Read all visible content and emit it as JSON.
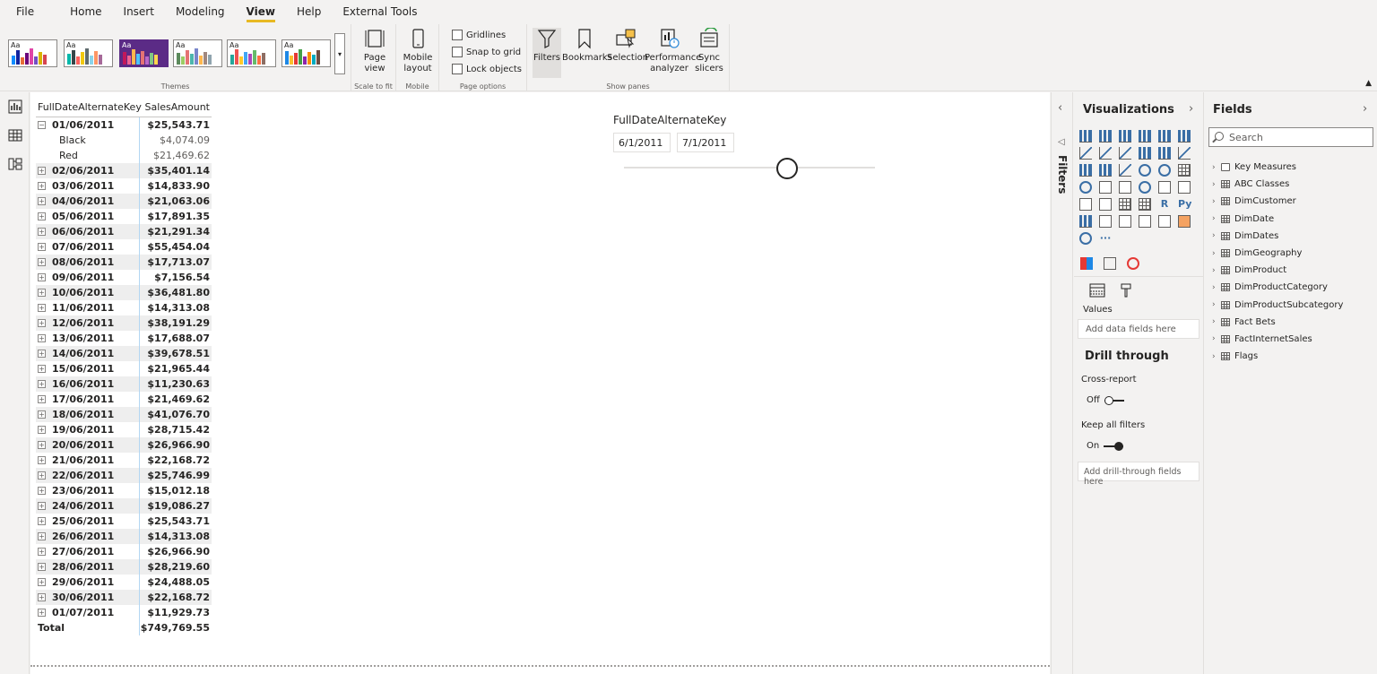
{
  "menu": [
    "File",
    "Home",
    "Insert",
    "Modeling",
    "View",
    "Help",
    "External Tools"
  ],
  "menu_active": "View",
  "ribbon": {
    "themes_label": "Themes",
    "page_view": "Page view",
    "scale_to_fit": "Scale to fit",
    "mobile_layout": "Mobile layout",
    "mobile_group": "Mobile",
    "gridlines": "Gridlines",
    "snap_to_grid": "Snap to grid",
    "lock_objects": "Lock objects",
    "page_options": "Page options",
    "filters": "Filters",
    "bookmarks": "Bookmarks",
    "selection": "Selection",
    "performance_analyzer": "Performance analyzer",
    "sync_slicers": "Sync slicers",
    "show_panes": "Show panes",
    "theme_aa": "Aa"
  },
  "table": {
    "col1": "FullDateAlternateKey",
    "col2": "SalesAmount",
    "rows": [
      {
        "key": "01/06/2011",
        "value": "$25,543.71",
        "expanded": true
      },
      {
        "key": "Black",
        "value": "$4,074.09",
        "child": true
      },
      {
        "key": "Red",
        "value": "$21,469.62",
        "child": true
      },
      {
        "key": "02/06/2011",
        "value": "$35,401.14"
      },
      {
        "key": "03/06/2011",
        "value": "$14,833.90"
      },
      {
        "key": "04/06/2011",
        "value": "$21,063.06"
      },
      {
        "key": "05/06/2011",
        "value": "$17,891.35"
      },
      {
        "key": "06/06/2011",
        "value": "$21,291.34"
      },
      {
        "key": "07/06/2011",
        "value": "$55,454.04"
      },
      {
        "key": "08/06/2011",
        "value": "$17,713.07"
      },
      {
        "key": "09/06/2011",
        "value": "$7,156.54"
      },
      {
        "key": "10/06/2011",
        "value": "$36,481.80"
      },
      {
        "key": "11/06/2011",
        "value": "$14,313.08"
      },
      {
        "key": "12/06/2011",
        "value": "$38,191.29"
      },
      {
        "key": "13/06/2011",
        "value": "$17,688.07"
      },
      {
        "key": "14/06/2011",
        "value": "$39,678.51"
      },
      {
        "key": "15/06/2011",
        "value": "$21,965.44"
      },
      {
        "key": "16/06/2011",
        "value": "$11,230.63"
      },
      {
        "key": "17/06/2011",
        "value": "$21,469.62"
      },
      {
        "key": "18/06/2011",
        "value": "$41,076.70"
      },
      {
        "key": "19/06/2011",
        "value": "$28,715.42"
      },
      {
        "key": "20/06/2011",
        "value": "$26,966.90"
      },
      {
        "key": "21/06/2011",
        "value": "$22,168.72"
      },
      {
        "key": "22/06/2011",
        "value": "$25,746.99"
      },
      {
        "key": "23/06/2011",
        "value": "$15,012.18"
      },
      {
        "key": "24/06/2011",
        "value": "$19,086.27"
      },
      {
        "key": "25/06/2011",
        "value": "$25,543.71"
      },
      {
        "key": "26/06/2011",
        "value": "$14,313.08"
      },
      {
        "key": "27/06/2011",
        "value": "$26,966.90"
      },
      {
        "key": "28/06/2011",
        "value": "$28,219.60"
      },
      {
        "key": "29/06/2011",
        "value": "$24,488.05"
      },
      {
        "key": "30/06/2011",
        "value": "$22,168.72"
      },
      {
        "key": "01/07/2011",
        "value": "$11,929.73"
      }
    ],
    "total_label": "Total",
    "total_value": "$749,769.55"
  },
  "slicer": {
    "title": "FullDateAlternateKey",
    "start": "6/1/2011",
    "end": "7/1/2011"
  },
  "filters_label": "Filters",
  "viz": {
    "title": "Visualizations",
    "values_label": "Values",
    "values_placeholder": "Add data fields here",
    "drill_title": "Drill through",
    "cross_report": "Cross-report",
    "cross_report_state": "Off",
    "keep_filters": "Keep all filters",
    "keep_filters_state": "On",
    "drill_placeholder": "Add drill-through fields here",
    "r_label": "R",
    "py_label": "Py",
    "more_label": "···"
  },
  "fields": {
    "title": "Fields",
    "search_placeholder": "Search",
    "items": [
      "Key Measures",
      "ABC Classes",
      "DimCustomer",
      "DimDate",
      "DimDates",
      "DimGeography",
      "DimProduct",
      "DimProductCategory",
      "DimProductSubcategory",
      "Fact Bets",
      "FactInternetSales",
      "Flags"
    ]
  },
  "colors": {
    "accent": "#e8b923",
    "theme_dark": "#5b2b86"
  }
}
